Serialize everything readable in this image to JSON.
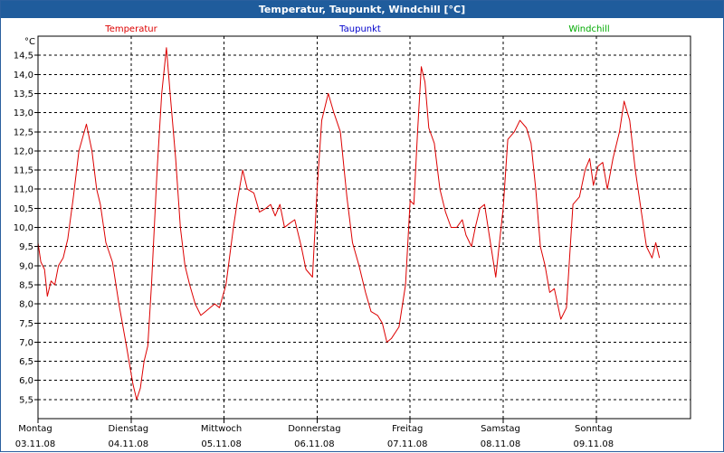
{
  "window": {
    "title": "Temperatur, Taupunkt, Windchill [°C]"
  },
  "chart_data": {
    "type": "line",
    "unit": "°C",
    "ylim": [
      5.0,
      15.0
    ],
    "grid": true,
    "y_ticks": [
      "5,5",
      "6,0",
      "6,5",
      "7,0",
      "7,5",
      "8,0",
      "8,5",
      "9,0",
      "9,5",
      "10,0",
      "10,5",
      "11,0",
      "11,5",
      "12,0",
      "12,5",
      "13,0",
      "13,5",
      "14,0",
      "14,5"
    ],
    "legend": [
      {
        "name": "Temperatur",
        "color": "#dd0000"
      },
      {
        "name": "Taupunkt",
        "color": "#0000cc"
      },
      {
        "name": "Windchill",
        "color": "#00aa00"
      }
    ],
    "days": [
      {
        "weekday": "Montag",
        "date": "03.11.08"
      },
      {
        "weekday": "Dienstag",
        "date": "04.11.08"
      },
      {
        "weekday": "Mittwoch",
        "date": "05.11.08"
      },
      {
        "weekday": "Donnerstag",
        "date": "06.11.08"
      },
      {
        "weekday": "Freitag",
        "date": "07.11.08"
      },
      {
        "weekday": "Samstag",
        "date": "08.11.08"
      },
      {
        "weekday": "Sonntag",
        "date": "09.11.08"
      }
    ],
    "series": [
      {
        "name": "Temperatur",
        "color": "#dd0000",
        "points": [
          [
            0.0,
            9.6
          ],
          [
            0.03,
            9.1
          ],
          [
            0.07,
            8.9
          ],
          [
            0.1,
            8.2
          ],
          [
            0.14,
            8.6
          ],
          [
            0.18,
            8.5
          ],
          [
            0.22,
            9.0
          ],
          [
            0.27,
            9.2
          ],
          [
            0.32,
            9.7
          ],
          [
            0.38,
            10.8
          ],
          [
            0.44,
            12.0
          ],
          [
            0.52,
            12.7
          ],
          [
            0.58,
            12.0
          ],
          [
            0.63,
            11.0
          ],
          [
            0.67,
            10.6
          ],
          [
            0.73,
            9.6
          ],
          [
            0.8,
            9.1
          ],
          [
            0.87,
            8.0
          ],
          [
            0.95,
            6.9
          ],
          [
            1.02,
            5.9
          ],
          [
            1.06,
            5.5
          ],
          [
            1.1,
            5.8
          ],
          [
            1.14,
            6.5
          ],
          [
            1.18,
            6.9
          ],
          [
            1.22,
            8.5
          ],
          [
            1.28,
            11.5
          ],
          [
            1.33,
            13.5
          ],
          [
            1.38,
            14.7
          ],
          [
            1.42,
            13.5
          ],
          [
            1.48,
            11.8
          ],
          [
            1.53,
            10.0
          ],
          [
            1.58,
            9.0
          ],
          [
            1.63,
            8.5
          ],
          [
            1.69,
            8.0
          ],
          [
            1.75,
            7.7
          ],
          [
            1.8,
            7.8
          ],
          [
            1.85,
            7.9
          ],
          [
            1.9,
            8.0
          ],
          [
            1.95,
            7.9
          ],
          [
            2.02,
            8.5
          ],
          [
            2.1,
            10.0
          ],
          [
            2.15,
            10.8
          ],
          [
            2.2,
            11.5
          ],
          [
            2.25,
            11.0
          ],
          [
            2.32,
            10.9
          ],
          [
            2.38,
            10.4
          ],
          [
            2.45,
            10.5
          ],
          [
            2.5,
            10.6
          ],
          [
            2.55,
            10.3
          ],
          [
            2.6,
            10.6
          ],
          [
            2.65,
            10.0
          ],
          [
            2.7,
            10.1
          ],
          [
            2.76,
            10.2
          ],
          [
            2.83,
            9.5
          ],
          [
            2.88,
            8.9
          ],
          [
            2.95,
            8.7
          ],
          [
            3.0,
            11.0
          ],
          [
            3.05,
            12.8
          ],
          [
            3.12,
            13.5
          ],
          [
            3.18,
            13.0
          ],
          [
            3.25,
            12.5
          ],
          [
            3.32,
            10.8
          ],
          [
            3.38,
            9.6
          ],
          [
            3.45,
            9.0
          ],
          [
            3.52,
            8.3
          ],
          [
            3.58,
            7.8
          ],
          [
            3.65,
            7.7
          ],
          [
            3.7,
            7.5
          ],
          [
            3.75,
            7.0
          ],
          [
            3.8,
            7.1
          ],
          [
            3.88,
            7.4
          ],
          [
            3.95,
            8.5
          ],
          [
            4.0,
            10.7
          ],
          [
            4.04,
            10.6
          ],
          [
            4.08,
            12.5
          ],
          [
            4.12,
            14.2
          ],
          [
            4.16,
            13.8
          ],
          [
            4.2,
            12.6
          ],
          [
            4.26,
            12.2
          ],
          [
            4.32,
            11.0
          ],
          [
            4.38,
            10.4
          ],
          [
            4.44,
            10.0
          ],
          [
            4.5,
            10.0
          ],
          [
            4.56,
            10.2
          ],
          [
            4.6,
            9.8
          ],
          [
            4.66,
            9.5
          ],
          [
            4.7,
            10.0
          ],
          [
            4.75,
            10.5
          ],
          [
            4.8,
            10.6
          ],
          [
            4.85,
            9.8
          ],
          [
            4.92,
            8.7
          ],
          [
            5.0,
            10.5
          ],
          [
            5.05,
            12.3
          ],
          [
            5.12,
            12.5
          ],
          [
            5.18,
            12.8
          ],
          [
            5.25,
            12.6
          ],
          [
            5.3,
            12.2
          ],
          [
            5.35,
            11.0
          ],
          [
            5.4,
            9.5
          ],
          [
            5.45,
            9.0
          ],
          [
            5.5,
            8.3
          ],
          [
            5.55,
            8.4
          ],
          [
            5.62,
            7.6
          ],
          [
            5.68,
            7.9
          ],
          [
            5.75,
            10.6
          ],
          [
            5.82,
            10.8
          ],
          [
            5.88,
            11.5
          ],
          [
            5.93,
            11.8
          ],
          [
            5.97,
            11.1
          ],
          [
            6.02,
            11.6
          ],
          [
            6.07,
            11.7
          ],
          [
            6.12,
            11.0
          ],
          [
            6.18,
            11.8
          ],
          [
            6.25,
            12.5
          ],
          [
            6.3,
            13.3
          ],
          [
            6.36,
            12.8
          ],
          [
            6.42,
            11.5
          ],
          [
            6.48,
            10.5
          ],
          [
            6.54,
            9.5
          ],
          [
            6.6,
            9.2
          ],
          [
            6.64,
            9.6
          ],
          [
            6.68,
            9.2
          ]
        ]
      }
    ]
  }
}
